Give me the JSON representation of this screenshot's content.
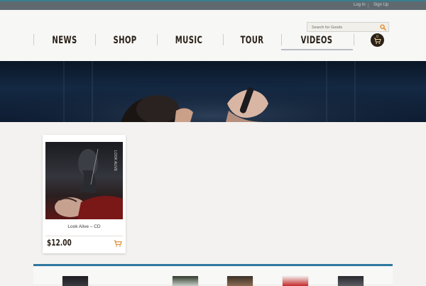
{
  "topbar": {
    "login": "Log In",
    "signup": "Sign Up"
  },
  "search": {
    "placeholder": "Search for Goods"
  },
  "nav": {
    "items": [
      "NEWS",
      "SHOP",
      "MUSIC",
      "TOUR",
      "VIDEOS"
    ],
    "active": "VIDEOS"
  },
  "cart": {
    "count": "0"
  },
  "products": [
    {
      "name": "Look Alive – CD",
      "price": "$12.00"
    }
  ],
  "colors": {
    "accent": "#2f78a0",
    "text_dark": "#2a2118",
    "cart_bg": "#2b2118",
    "search_icon": "#e0821c"
  }
}
